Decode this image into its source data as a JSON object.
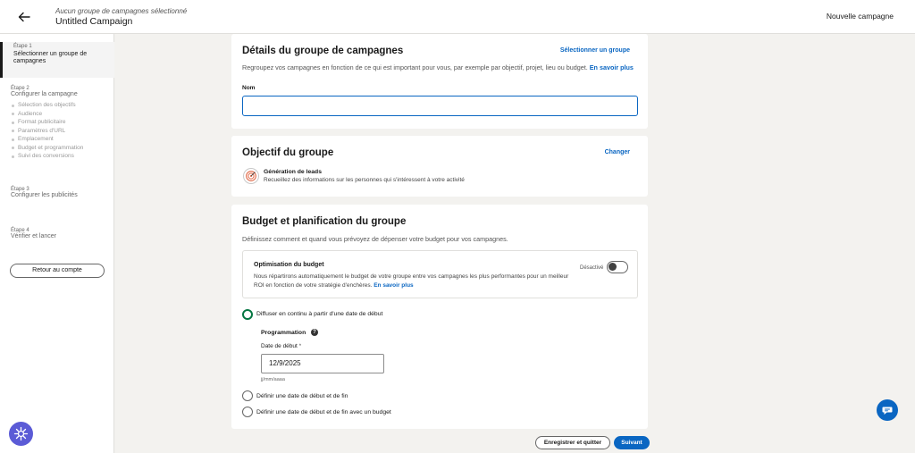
{
  "header": {
    "subtitle": "Aucun groupe de campagnes sélectionné",
    "title": "Untitled Campaign",
    "new_campaign": "Nouvelle campagne"
  },
  "sidebar": {
    "step1": {
      "label": "Étape 1",
      "title": "Sélectionner un groupe de campagnes"
    },
    "step2": {
      "label": "Étape 2",
      "title": "Configurer la campagne",
      "items": [
        "Sélection des objectifs",
        "Audience",
        "Format publicitaire",
        "Paramètres d'URL",
        "Emplacement",
        "Budget et programmation",
        "Suivi des conversions"
      ]
    },
    "step3": {
      "label": "Étape 3",
      "title": "Configurer les publicités"
    },
    "step4": {
      "label": "Étape 4",
      "title": "Vérifier et lancer"
    },
    "back_button": "Retour au compte"
  },
  "details": {
    "title": "Détails du groupe de campagnes",
    "select_link": "Sélectionner un groupe",
    "description": "Regroupez vos campagnes en fonction de ce qui est important pour vous, par exemple par objectif, projet, lieu ou budget.",
    "learn_more": "En savoir plus",
    "name_label": "Nom",
    "name_value": ""
  },
  "objective": {
    "title": "Objectif du groupe",
    "change_link": "Changer",
    "goal_title": "Génération de leads",
    "goal_desc": "Recueillez des informations sur les personnes qui s'intéressent à votre activité"
  },
  "budget": {
    "title": "Budget et planification du groupe",
    "description": "Définissez comment et quand vous prévoyez de dépenser votre budget pour vos campagnes.",
    "optimization_title": "Optimisation du budget",
    "optimization_desc": "Nous répartirons automatiquement le budget de votre groupe entre vos campagnes les plus performantes pour un meilleur ROI en fonction de votre stratégie d'enchères.",
    "optimization_learn_more": "En savoir plus",
    "toggle_state": "Désactivé",
    "options": [
      "Diffuser en continu à partir d'une date de début",
      "Définir une date de début et de fin",
      "Définir une date de début et de fin avec un budget"
    ],
    "selected_option": 0,
    "programming_label": "Programmation",
    "start_date_label": "Date de début",
    "required_mark": "*",
    "start_date_value": "12/9/2025",
    "date_format": "jj/mm/aaaa"
  },
  "footer": {
    "save_quit": "Enregistrer et quitter",
    "next": "Suivant"
  },
  "colors": {
    "primary": "#0a66c2",
    "selected_radio": "#057642",
    "help_fab": "#5b5bd6"
  }
}
